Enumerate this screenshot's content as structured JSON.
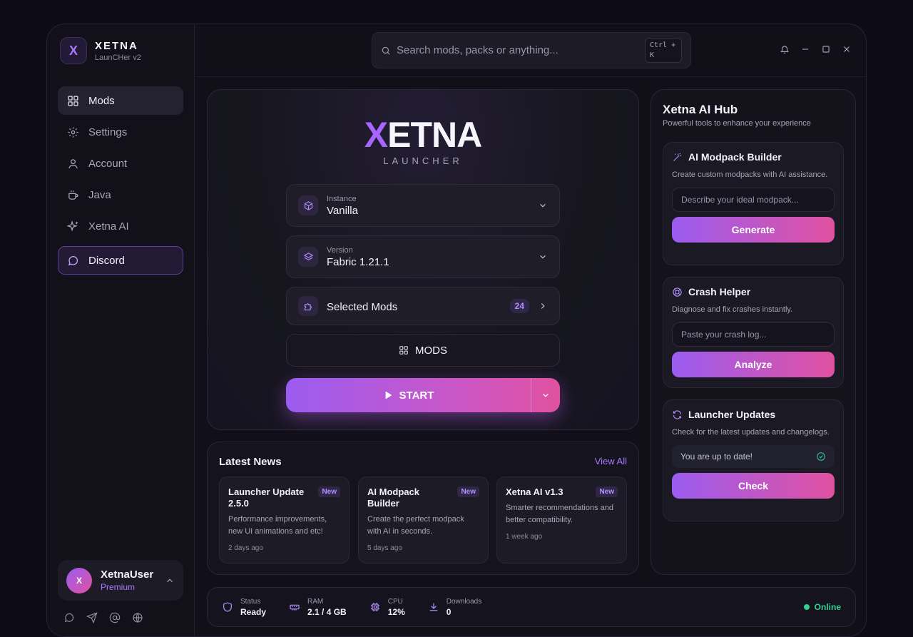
{
  "brand": {
    "logo_letter": "X",
    "name": "XETNA",
    "subtitle": "LaunCHer v2"
  },
  "sidebar": {
    "items": [
      {
        "label": "Mods",
        "icon": "grid-icon",
        "active": true
      },
      {
        "label": "Settings",
        "icon": "gear-icon"
      },
      {
        "label": "Account",
        "icon": "user-icon"
      },
      {
        "label": "Java",
        "icon": "coffee-cup-icon"
      },
      {
        "label": "Xetna AI",
        "icon": "sparkles-icon"
      },
      {
        "label": "Discord",
        "icon": "chat-bubble-icon",
        "highlight": true
      }
    ],
    "user": {
      "avatar_letter": "X",
      "name": "XetnaUser",
      "plan": "Premium"
    },
    "socials": [
      "chat-bubble-icon",
      "send-icon",
      "at-icon",
      "globe-icon"
    ]
  },
  "search": {
    "placeholder": "Search mods, packs or anything...",
    "shortcut": "Ctrl + K"
  },
  "hero": {
    "logo_x": "X",
    "logo_rest": "ETNA",
    "logo_sub": "LAUNCHER",
    "instance": {
      "label": "Instance",
      "value": "Vanilla"
    },
    "version": {
      "label": "Version",
      "value": "Fabric 1.21.1"
    },
    "selected_mods": {
      "label": "Selected Mods",
      "count": "24"
    },
    "mods_button": "MODS",
    "start_button": "START"
  },
  "news": {
    "title": "Latest News",
    "view_all": "View All",
    "cards": [
      {
        "title": "Launcher Update 2.5.0",
        "badge": "New",
        "desc": "Performance improvements, new UI animations and etc!",
        "time": "2 days ago"
      },
      {
        "title": "AI Modpack Builder",
        "badge": "New",
        "desc": "Create the perfect modpack with AI in seconds.",
        "time": "5 days ago"
      },
      {
        "title": "Xetna AI v1.3",
        "badge": "New",
        "desc": "Smarter recommendations and better compatibility.",
        "time": "1 week ago"
      }
    ]
  },
  "hub": {
    "title": "Xetna AI Hub",
    "subtitle": "Powerful tools to enhance your experience",
    "modpack": {
      "title": "AI Modpack Builder",
      "desc": "Create custom modpacks with AI assistance.",
      "placeholder": "Describe your ideal modpack...",
      "button": "Generate"
    },
    "crash": {
      "title": "Crash Helper",
      "desc": "Diagnose and fix crashes instantly.",
      "placeholder": "Paste your crash log...",
      "button": "Analyze"
    },
    "updates": {
      "title": "Launcher Updates",
      "desc": "Check for the latest updates and changelogs.",
      "status": "You are up to date!",
      "button": "Check"
    }
  },
  "status": {
    "items": [
      {
        "label": "Status",
        "value": "Ready"
      },
      {
        "label": "RAM",
        "value": "2.1 / 4 GB"
      },
      {
        "label": "CPU",
        "value": "12%"
      },
      {
        "label": "Downloads",
        "value": "0"
      }
    ],
    "online": "Online"
  },
  "colors": {
    "accent": "#9b5cf0",
    "accent2": "#e052a0",
    "online": "#2fd08f",
    "background": "#0d0c16"
  }
}
